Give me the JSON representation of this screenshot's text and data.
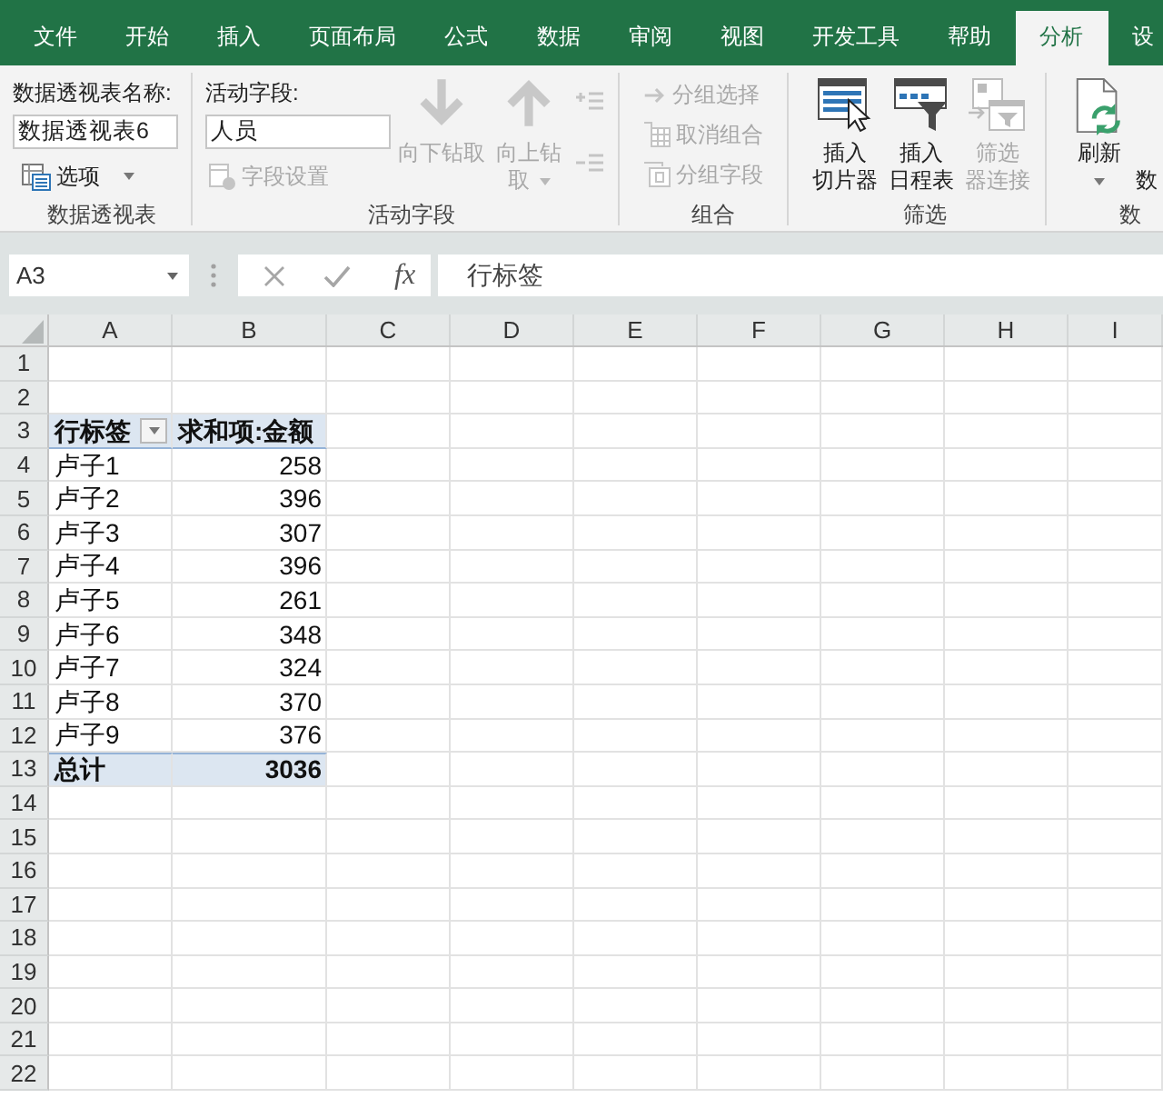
{
  "ribbon": {
    "tabs": [
      {
        "label": "文件",
        "selected": false
      },
      {
        "label": "开始",
        "selected": false
      },
      {
        "label": "插入",
        "selected": false
      },
      {
        "label": "页面布局",
        "selected": false
      },
      {
        "label": "公式",
        "selected": false
      },
      {
        "label": "数据",
        "selected": false
      },
      {
        "label": "审阅",
        "selected": false
      },
      {
        "label": "视图",
        "selected": false
      },
      {
        "label": "开发工具",
        "selected": false
      },
      {
        "label": "帮助",
        "selected": false
      },
      {
        "label": "分析",
        "selected": true
      },
      {
        "label": "设",
        "selected": false
      }
    ],
    "pivot_table_group": {
      "label": "数据透视表",
      "name_caption": "数据透视表名称:",
      "name_value": "数据透视表6",
      "options_button": {
        "label": "选项",
        "dropdown": true
      }
    },
    "active_field_group": {
      "label": "活动字段",
      "field_caption": "活动字段:",
      "field_value": "人员",
      "field_settings_button": {
        "label": "字段设置",
        "disabled": true
      },
      "drill_buttons": [
        {
          "label_lines": [
            "向下钻取"
          ],
          "disabled": true,
          "dropdown": false
        },
        {
          "label_lines": [
            "向上钻",
            "取"
          ],
          "disabled": true,
          "dropdown": true
        }
      ],
      "expand_collapse_buttons": [
        {
          "disabled": true
        },
        {
          "disabled": true
        }
      ]
    },
    "group_group": {
      "label": "组合",
      "buttons": [
        {
          "label": "分组选择",
          "disabled": true
        },
        {
          "label": "取消组合",
          "disabled": true
        },
        {
          "label": "分组字段",
          "disabled": true
        }
      ]
    },
    "filter_group": {
      "label": "筛选",
      "buttons": [
        {
          "label_lines": [
            "插入",
            "切片器"
          ],
          "disabled": false
        },
        {
          "label_lines": [
            "插入",
            "日程表"
          ],
          "disabled": false
        },
        {
          "label_lines": [
            "筛选",
            "器连接"
          ],
          "disabled": true
        }
      ]
    },
    "data_group": {
      "label": "数",
      "refresh_button": {
        "label": "刷新",
        "dropdown": true
      },
      "partial_button": {
        "label": "数"
      }
    }
  },
  "formula_bar": {
    "name_box": "A3",
    "function_label": "fx",
    "formula": "行标签"
  },
  "sheet": {
    "columns": [
      "A",
      "B",
      "C",
      "D",
      "E",
      "F",
      "G",
      "H",
      "I"
    ],
    "rows": [
      {
        "number": "1",
        "kind": "empty"
      },
      {
        "number": "2",
        "kind": "empty"
      },
      {
        "number": "3",
        "kind": "pivot_header",
        "cells": [
          "行标签",
          "求和项:金额"
        ]
      },
      {
        "number": "4",
        "kind": "pivot_item",
        "cells": [
          "卢子1",
          "258"
        ]
      },
      {
        "number": "5",
        "kind": "pivot_item",
        "cells": [
          "卢子2",
          "396"
        ]
      },
      {
        "number": "6",
        "kind": "pivot_item",
        "cells": [
          "卢子3",
          "307"
        ]
      },
      {
        "number": "7",
        "kind": "pivot_item",
        "cells": [
          "卢子4",
          "396"
        ]
      },
      {
        "number": "8",
        "kind": "pivot_item",
        "cells": [
          "卢子5",
          "261"
        ]
      },
      {
        "number": "9",
        "kind": "pivot_item",
        "cells": [
          "卢子6",
          "348"
        ]
      },
      {
        "number": "10",
        "kind": "pivot_item",
        "cells": [
          "卢子7",
          "324"
        ]
      },
      {
        "number": "11",
        "kind": "pivot_item",
        "cells": [
          "卢子8",
          "370"
        ]
      },
      {
        "number": "12",
        "kind": "pivot_item",
        "cells": [
          "卢子9",
          "376"
        ]
      },
      {
        "number": "13",
        "kind": "pivot_total",
        "cells": [
          "总计",
          "3036"
        ]
      },
      {
        "number": "14",
        "kind": "empty"
      },
      {
        "number": "15",
        "kind": "empty"
      },
      {
        "number": "16",
        "kind": "empty"
      },
      {
        "number": "17",
        "kind": "empty"
      },
      {
        "number": "18",
        "kind": "empty"
      },
      {
        "number": "19",
        "kind": "empty"
      },
      {
        "number": "20",
        "kind": "empty"
      },
      {
        "number": "21",
        "kind": "empty"
      },
      {
        "number": "22",
        "kind": "empty"
      }
    ]
  }
}
